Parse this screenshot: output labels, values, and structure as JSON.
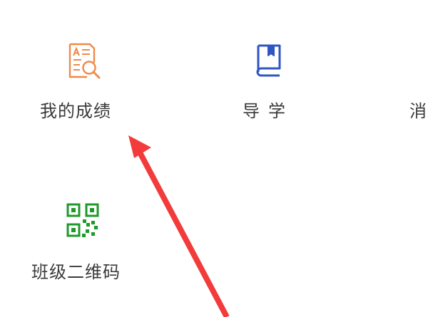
{
  "menu": {
    "items": [
      {
        "label": "我的成绩",
        "icon": "grades-search-icon",
        "color": "#ee8a4a"
      },
      {
        "label": "导学",
        "icon": "book-icon",
        "color": "#2f56c2"
      },
      {
        "label": "消",
        "icon": "",
        "color": ""
      },
      {
        "label": "班级二维码",
        "icon": "qr-code-icon",
        "color": "#1e9a2a"
      }
    ]
  },
  "annotation": {
    "arrow_color": "#f23b3b"
  }
}
